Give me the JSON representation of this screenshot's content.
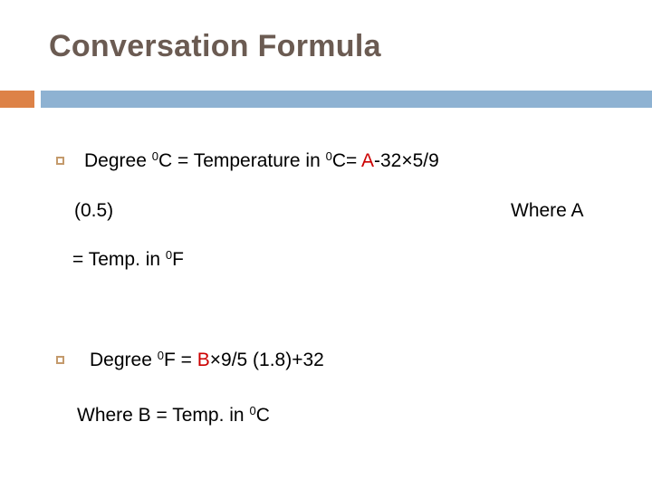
{
  "slide": {
    "title": "Conversation Formula",
    "title_color": "#6B5B52",
    "background_color": "#ffffff",
    "divider": {
      "accent_color": "#DD8247",
      "bar_color": "#8EB2D2"
    },
    "bullet": {
      "glyph": "hollow-square",
      "color": "#C49A6C"
    },
    "highlight_color": "#CC0000",
    "body": [
      {
        "id": "formula-celsius",
        "bulleted": true,
        "segments": {
          "pre": "Degree ",
          "deg1": "0",
          "unit1": "C = Temperature in ",
          "deg2": "0",
          "unit2": "C= ",
          "variable": "A",
          "post": "-32×5/9"
        }
      },
      {
        "id": "factor-line",
        "bulleted": false,
        "left_text": "(0.5)",
        "right_text": "Where A"
      },
      {
        "id": "equals-temp-f",
        "bulleted": false,
        "segments": {
          "pre": "= Temp. in ",
          "deg": "0",
          "unit": "F"
        }
      },
      {
        "id": "formula-fahrenheit",
        "bulleted": true,
        "segments": {
          "pre": "Degree ",
          "deg": "0",
          "unit": "F = ",
          "variable": "B",
          "post": "×9/5 (1.8)+32"
        }
      },
      {
        "id": "where-b",
        "bulleted": false,
        "segments": {
          "pre": "Where B = Temp. in ",
          "deg": "0",
          "unit": "C"
        }
      }
    ]
  }
}
